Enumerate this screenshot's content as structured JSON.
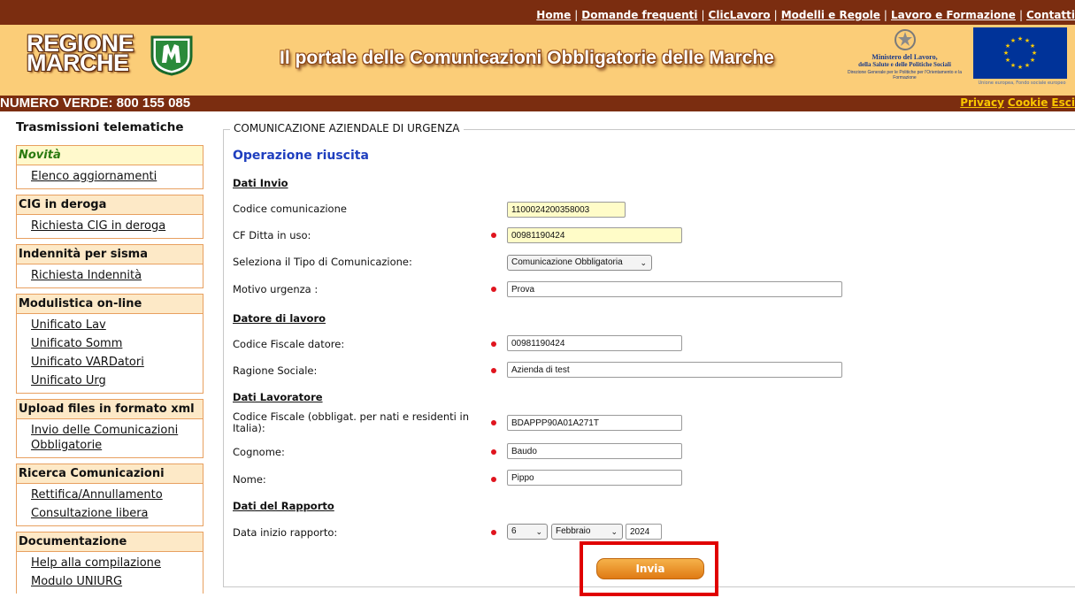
{
  "top_nav": {
    "links": [
      "Home",
      "Domande frequenti",
      "ClicLavoro",
      "Modelli e Regole",
      "Lavoro e Formazione",
      "Contatti"
    ]
  },
  "header": {
    "logo_line1": "REGIONE",
    "logo_line2": "MARCHE",
    "title": "Il portale delle Comunicazioni Obbligatorie delle Marche",
    "ministero_line1": "Ministero del Lavoro,",
    "ministero_line2": "della Salute e delle Politiche Sociali",
    "ministero_line3": "Direzione Generale per le Politiche per l'Orientamento e la Formazione",
    "eu_text": "Unione europea, Fondo sociale europeo"
  },
  "subbar": {
    "numero_verde": "NUMERO VERDE: 800 155 085",
    "privacy": "Privacy",
    "cookie": "Cookie",
    "esci": "Esci"
  },
  "sidebar": {
    "title": "Trasmissioni telematiche",
    "sections": [
      {
        "head": "Novità",
        "items": [
          "Elenco aggiornamenti"
        ]
      },
      {
        "head": "CIG in deroga",
        "items": [
          "Richiesta CIG in deroga"
        ]
      },
      {
        "head": "Indennità per sisma",
        "items": [
          "Richiesta Indennità"
        ]
      },
      {
        "head": "Modulistica on-line",
        "items": [
          "Unificato Lav",
          "Unificato Somm",
          "Unificato VARDatori",
          "Unificato Urg"
        ]
      },
      {
        "head": "Upload files in formato xml",
        "items": [
          "Invio delle Comunicazioni Obbligatorie"
        ]
      },
      {
        "head": "Ricerca Comunicazioni",
        "items": [
          "Rettifica/Annullamento",
          "Consultazione libera"
        ]
      },
      {
        "head": "Documentazione",
        "items": [
          "Help alla compilazione",
          "Modulo UNIURG"
        ]
      }
    ]
  },
  "form": {
    "legend": "COMUNICAZIONE AZIENDALE DI URGENZA",
    "status": "Operazione riuscita",
    "sec_invio": "Dati Invio",
    "codice_comunicazione_label": "Codice comunicazione",
    "codice_comunicazione": "1100024200358003",
    "cf_ditta_label": "CF Ditta in uso:",
    "cf_ditta": "00981190424",
    "tipo_label": "Seleziona il Tipo di Comunicazione:",
    "tipo_value": "Comunicazione Obbligatoria",
    "motivo_label": "Motivo urgenza :",
    "motivo": "Prova",
    "sec_datore": "Datore di lavoro",
    "cf_datore_label": "Codice Fiscale datore:",
    "cf_datore": "00981190424",
    "ragione_label": "Ragione Sociale:",
    "ragione": "Azienda di test",
    "sec_lavoratore": "Dati Lavoratore",
    "cf_lav_label": "Codice Fiscale (obbligat. per nati e residenti in Italia):",
    "cf_lav": "BDAPPP90A01A271T",
    "cognome_label": "Cognome:",
    "cognome": "Baudo",
    "nome_label": "Nome:",
    "nome": "Pippo",
    "sec_rapporto": "Dati del Rapporto",
    "data_label": "Data inizio rapporto:",
    "giorno": "6",
    "mese": "Febbraio",
    "anno": "2024",
    "submit": "Invia"
  },
  "colors": {
    "brand_dark": "#7b2d10",
    "header_bg": "#fbcd78",
    "required": "#e0141e",
    "status": "#1f3fbf",
    "highlight": "#e00000"
  }
}
